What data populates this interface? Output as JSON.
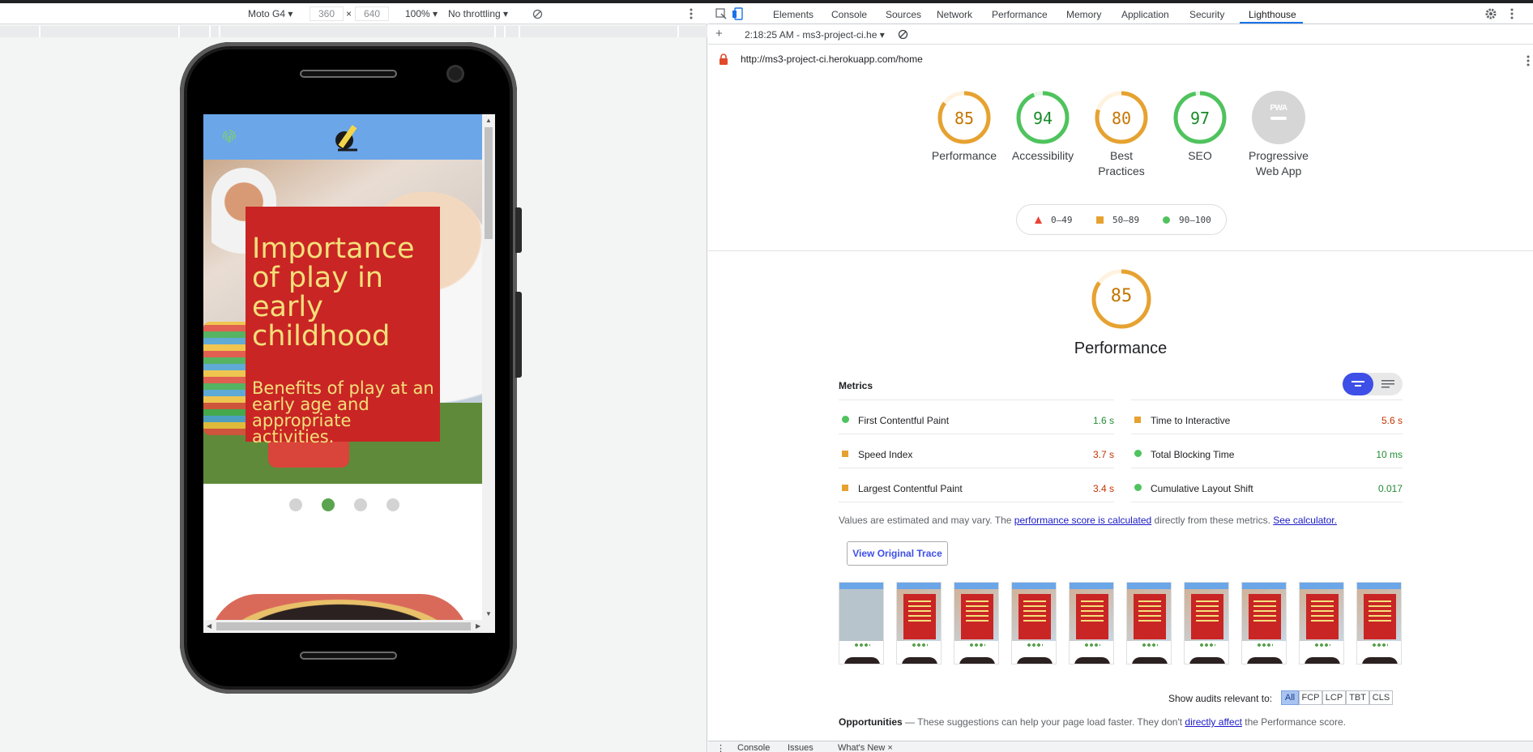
{
  "device_toolbar": {
    "device": "Moto G4 ▾",
    "width": "360",
    "times": "×",
    "height": "640",
    "zoom": "100% ▾",
    "throttling": "No throttling ▾"
  },
  "website": {
    "hero_title": "Importance of play in early childhood",
    "hero_subtitle": "Benefits of play at an early age and appropriate activities.",
    "carousel_dots": 4,
    "carousel_active": 1
  },
  "devtools": {
    "tabs": [
      "Elements",
      "Console",
      "Sources",
      "Network",
      "Performance",
      "Memory",
      "Application",
      "Security",
      "Lighthouse"
    ],
    "active_tab": "Lighthouse",
    "session": "2:18:25 AM - ms3-project-ci.he ▾",
    "url": "http://ms3-project-ci.herokuapp.com/home"
  },
  "lighthouse": {
    "categories": [
      {
        "label": "Performance",
        "score": 85,
        "color": "#e6a231"
      },
      {
        "label": "Accessibility",
        "score": 94,
        "color": "#4fc35d"
      },
      {
        "label": "Best Practices",
        "score": 80,
        "color": "#e6a231"
      },
      {
        "label": "SEO",
        "score": 97,
        "color": "#4fc35d"
      }
    ],
    "pwa": {
      "label": "Progressive Web App",
      "badge": "PWA"
    },
    "legend": [
      {
        "range": "0–49",
        "color": "#ea4335"
      },
      {
        "range": "50–89",
        "color": "#e6a231"
      },
      {
        "range": "90–100",
        "color": "#4fc35d"
      }
    ],
    "performance_title": "Performance",
    "performance_score": 85,
    "metrics_header": "Metrics",
    "metrics": [
      {
        "name": "First Contentful Paint",
        "value": "1.6 s",
        "status": "good"
      },
      {
        "name": "Time to Interactive",
        "value": "5.6 s",
        "status": "average"
      },
      {
        "name": "Speed Index",
        "value": "3.7 s",
        "status": "average"
      },
      {
        "name": "Total Blocking Time",
        "value": "10 ms",
        "status": "good"
      },
      {
        "name": "Largest Contentful Paint",
        "value": "3.4 s",
        "status": "average"
      },
      {
        "name": "Cumulative Layout Shift",
        "value": "0.017",
        "status": "good"
      }
    ],
    "note_prefix": "Values are estimated and may vary. The ",
    "note_link1": "performance score is calculated",
    "note_middle": " directly from these metrics. ",
    "note_link2": "See calculator.",
    "trace_button": "View Original Trace",
    "filmstrip_frames": 10,
    "audits_label": "Show audits relevant to:",
    "audit_filters": [
      "All",
      "FCP",
      "LCP",
      "TBT",
      "CLS"
    ],
    "opps_title": "Opportunities",
    "opps_text": " — These suggestions can help your page load faster. They don't ",
    "opps_link": "directly affect",
    "opps_end": " the Performance score."
  },
  "drawer": {
    "tabs": [
      "Console",
      "Issues",
      "What's New ×"
    ]
  }
}
